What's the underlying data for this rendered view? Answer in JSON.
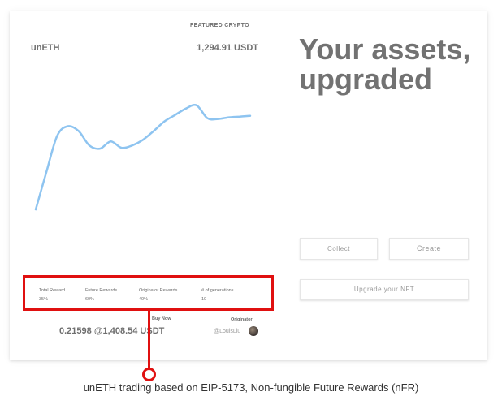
{
  "card": {
    "featured_label": "FEATURED CRYPTO",
    "token_name": "unETH",
    "token_price": "1,294.91 USDT",
    "headline": "Your assets, upgraded"
  },
  "chart_data": {
    "type": "line",
    "title": "",
    "xlabel": "",
    "ylabel": "",
    "x": [
      0,
      1,
      2,
      3,
      4,
      5,
      6,
      7,
      8,
      9,
      10,
      11,
      12,
      13,
      14,
      15,
      16,
      17,
      18,
      19,
      20
    ],
    "series": [
      {
        "values": [
          8,
          55,
          100,
          112,
          106,
          88,
          84,
          93,
          85,
          88,
          95,
          106,
          118,
          126,
          134,
          138,
          122,
          121,
          123,
          124,
          125
        ]
      }
    ],
    "ylim": [
      0,
      150
    ],
    "grid": false,
    "color": "#8ec4f0"
  },
  "buttons": {
    "collect": "Collect",
    "create": "Create",
    "upgrade": "Upgrade your NFT"
  },
  "stats": [
    {
      "label": "Total Reward",
      "value": "35%"
    },
    {
      "label": "Future Rewards",
      "value": "60%"
    },
    {
      "label": "Originator Rewards",
      "value": "40%"
    },
    {
      "label": "# of generations",
      "value": "10"
    }
  ],
  "buy": {
    "label": "Buy Now",
    "price": "0.21598 @1,408.54 USDT"
  },
  "originator": {
    "label": "Originator",
    "handle": "@LouisLiu"
  },
  "caption": "unETH trading based on EIP-5173, Non-fungible Future Rewards (nFR)",
  "colors": {
    "accent_red": "#e01010",
    "chart_line": "#8ec4f0"
  }
}
